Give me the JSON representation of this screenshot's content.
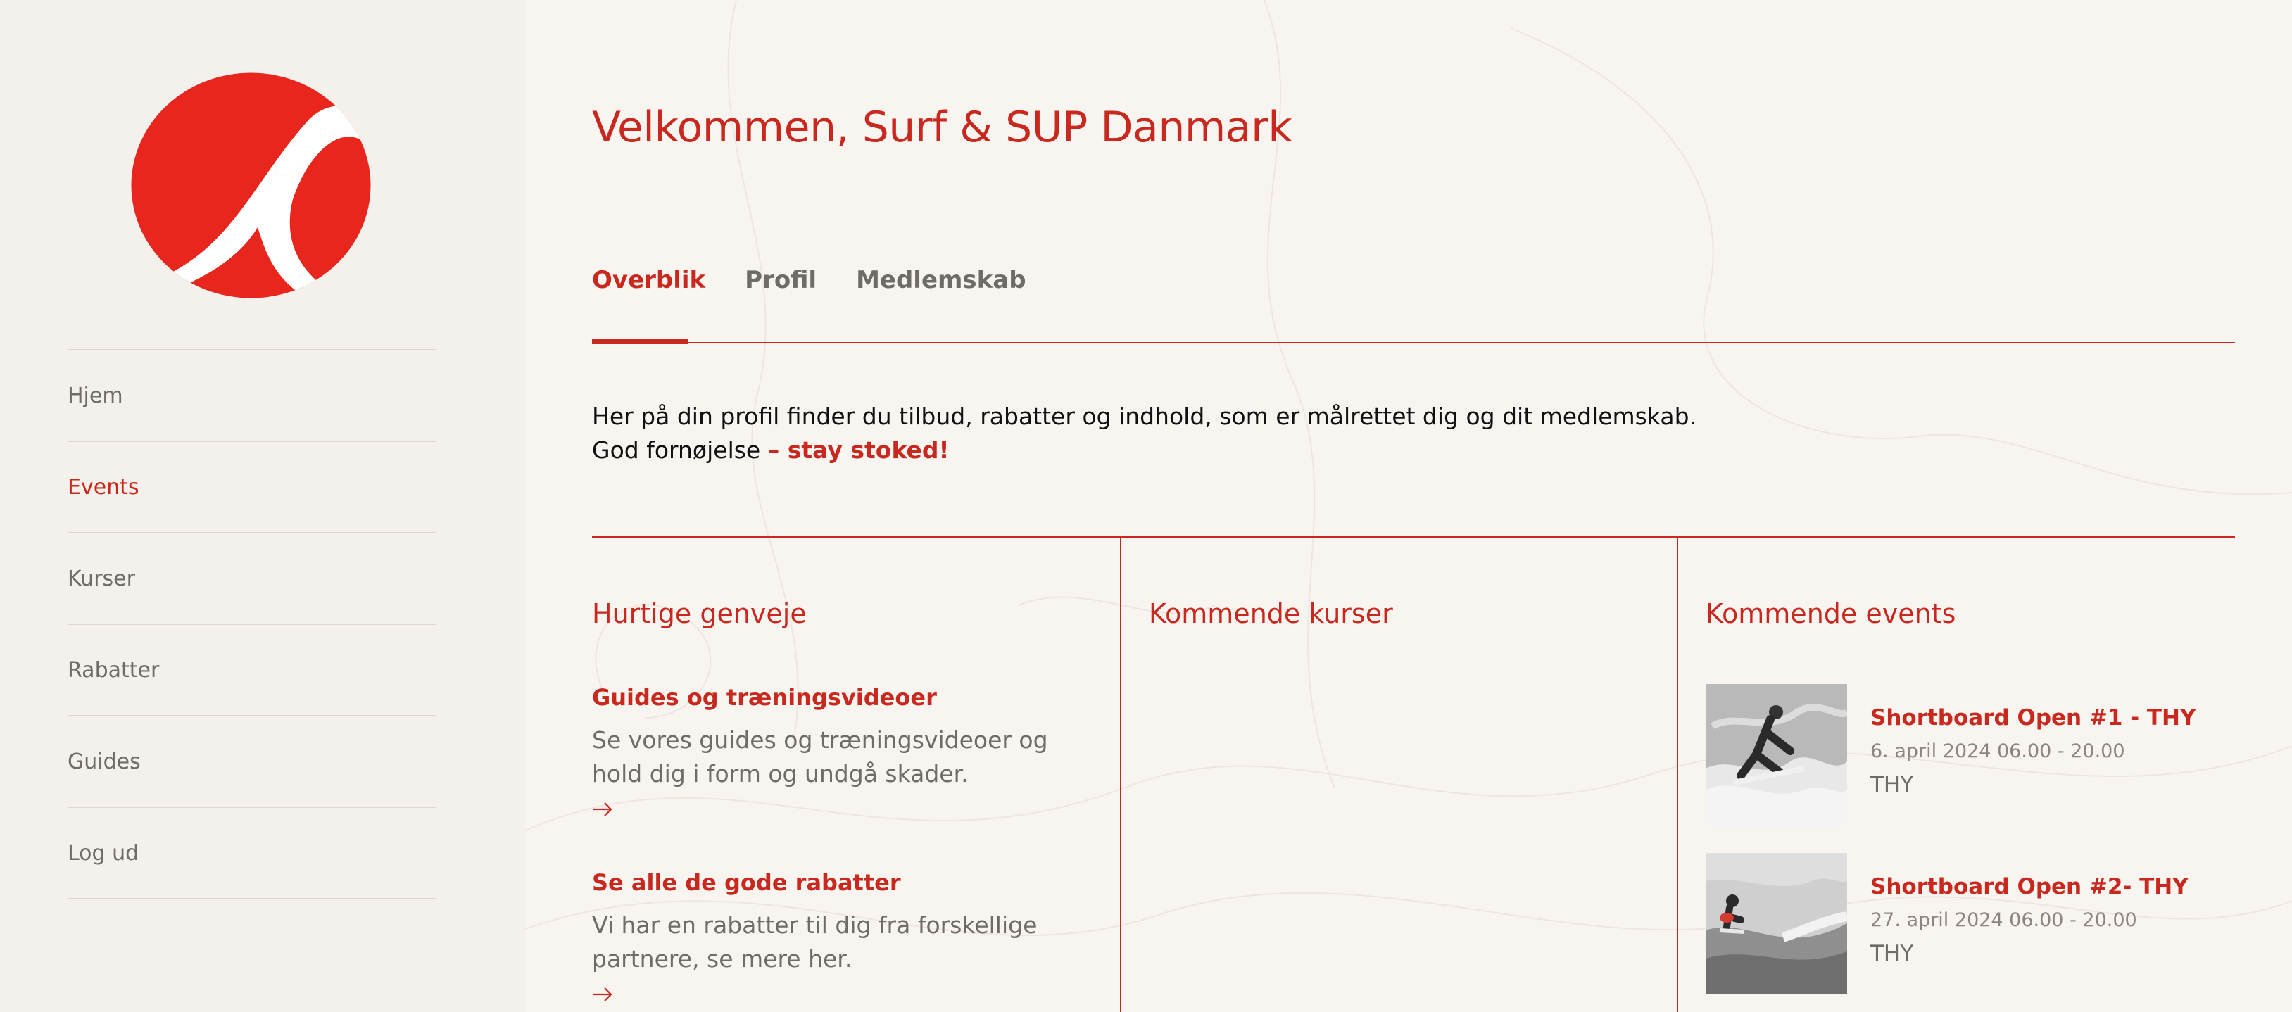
{
  "sidebar": {
    "items": [
      {
        "label": "Hjem"
      },
      {
        "label": "Events"
      },
      {
        "label": "Kurser"
      },
      {
        "label": "Rabatter"
      },
      {
        "label": "Guides"
      },
      {
        "label": "Log ud"
      }
    ]
  },
  "main": {
    "title": "Velkommen, Surf & SUP Danmark",
    "tabs": [
      {
        "label": "Overblik"
      },
      {
        "label": "Profil"
      },
      {
        "label": "Medlemskab"
      }
    ],
    "intro": {
      "text": "Her på din profil finder du tilbud, rabatter og indhold, som er målrettet dig og dit medlemskab. God fornøjelse ",
      "emphasis": "– stay stoked!"
    },
    "columns": {
      "shortcuts": {
        "title": "Hurtige genveje",
        "items": [
          {
            "title": "Guides og træningsvideoer",
            "description": "Se vores guides og træningsvideoer og hold dig i form og undgå skader."
          },
          {
            "title": "Se alle de gode rabatter",
            "description": "Vi har en rabatter til dig fra forskellige partnere, se mere her."
          }
        ]
      },
      "courses": {
        "title": "Kommende kurser"
      },
      "events": {
        "title": "Kommende events",
        "items": [
          {
            "title": "Shortboard Open #1 - THY",
            "date": "6. april 2024 06.00 - 20.00",
            "location": "THY"
          },
          {
            "title": "Shortboard Open #2- THY",
            "date": "27. april 2024 06.00 - 20.00",
            "location": "THY"
          }
        ]
      }
    }
  },
  "colors": {
    "accent": "#c8281e",
    "sidebar_bg": "#f4f0eb",
    "page_bg": "#f8f5f1",
    "muted_text": "#6f6b67"
  }
}
